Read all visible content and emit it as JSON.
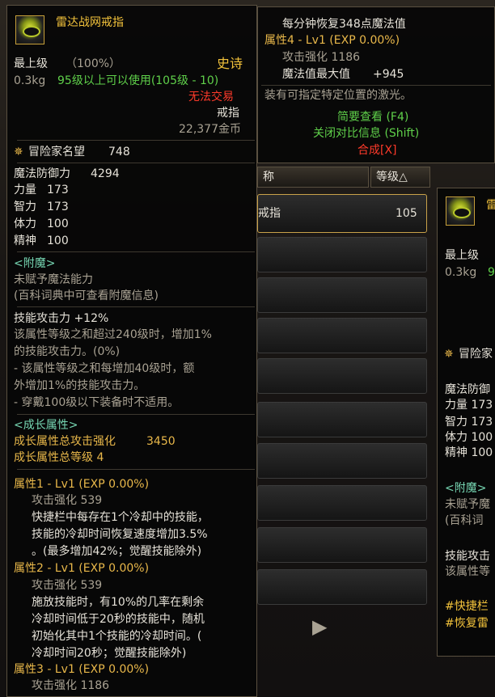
{
  "tooltip_main": {
    "item_name": "雷达战网戒指",
    "grade": "最上级",
    "grade_pct": "（100%）",
    "rarity": "史诗",
    "weight": "0.3kg",
    "level_req": "95级以上可以使用(105级 - 10)",
    "trade": "无法交易",
    "type": "戒指",
    "price": "22,377金币",
    "fame_label": "冒险家名望",
    "fame_value": "748",
    "stats": [
      {
        "label": "魔法防御力",
        "value": "4294"
      },
      {
        "label": "力量",
        "value": "173"
      },
      {
        "label": "智力",
        "value": "173"
      },
      {
        "label": "体力",
        "value": "100"
      },
      {
        "label": "精神",
        "value": "100"
      }
    ],
    "enchant_title": "<附魔>",
    "enchant_none": "未赋予魔法能力",
    "enchant_hint": "(百科词典中可查看附魔信息)",
    "skill_atk": "技能攻击力 +12%",
    "desc": [
      "该属性等级之和超过240级时，增加1%",
      "的技能攻击力。(0%)",
      "- 该属性等级之和每增加40级时，额",
      "外增加1%的技能攻击力。",
      "- 穿戴100级以下装备时不适用。"
    ],
    "growth_title": "<成长属性>",
    "growth_total_label": "成长属性总攻击强化",
    "growth_total_value": "3450",
    "growth_level": "成长属性总等级 4",
    "props": [
      {
        "title": "属性1 - Lv1 (EXP 0.00%)",
        "atk": "攻击强化 539",
        "lines": [
          "快捷栏中每存在1个冷却中的技能，",
          "技能的冷却时间恢复速度增加3.5%",
          "。(最多增加42%；觉醒技能除外)"
        ]
      },
      {
        "title": "属性2 - Lv1 (EXP 0.00%)",
        "atk": "攻击强化 539",
        "lines": [
          "施放技能时，有10%的几率在剩余",
          "冷却时间低于20秒的技能中，随机",
          "初始化其中1个技能的冷却时间。(",
          "冷却时间20秒；觉醒技能除外)"
        ]
      },
      {
        "title": "属性3 - Lv1 (EXP 0.00%)",
        "atk": "攻击强化 1186",
        "lines": []
      }
    ]
  },
  "tooltip_cont": {
    "mana_regen": "每分钟恢复348点魔法值",
    "prop4_title": "属性4 - Lv1 (EXP 0.00%)",
    "prop4_atk": "攻击强化 1186",
    "mana_max_label": "魔法值最大值",
    "mana_max_value": "+945",
    "laser": "装有可指定特定位置的激光。",
    "brief": "简要查看 (F4)",
    "close_compare": "关闭对比信息 (Shift)",
    "craft": "合成[X]"
  },
  "list": {
    "col_name": "称",
    "col_level": "等级△",
    "item_name": "戒指",
    "item_level": "105"
  },
  "tooltip_right": {
    "name_frag": "雷",
    "grade_frag": "最上级",
    "weight": "0.3kg",
    "weight_frag": "9",
    "fame_frag": "冒险家",
    "stats_frag": [
      "魔法防御",
      "力量 173",
      "智力 173",
      "体力 100",
      "精神 100"
    ],
    "enchant_frag": "<附魔>",
    "enchant_none_frag": "未赋予魔",
    "enchant_hint_frag": "(百科词",
    "skill_frag": "技能攻击",
    "desc_frag": "该属性等",
    "shortcut_frag1": "#快捷栏",
    "shortcut_frag2": "#恢复雷"
  },
  "colors": {
    "gold": "#f2c23b",
    "green": "#5fd04a",
    "red": "#ff3a2a",
    "cyan": "#76d6b2"
  }
}
